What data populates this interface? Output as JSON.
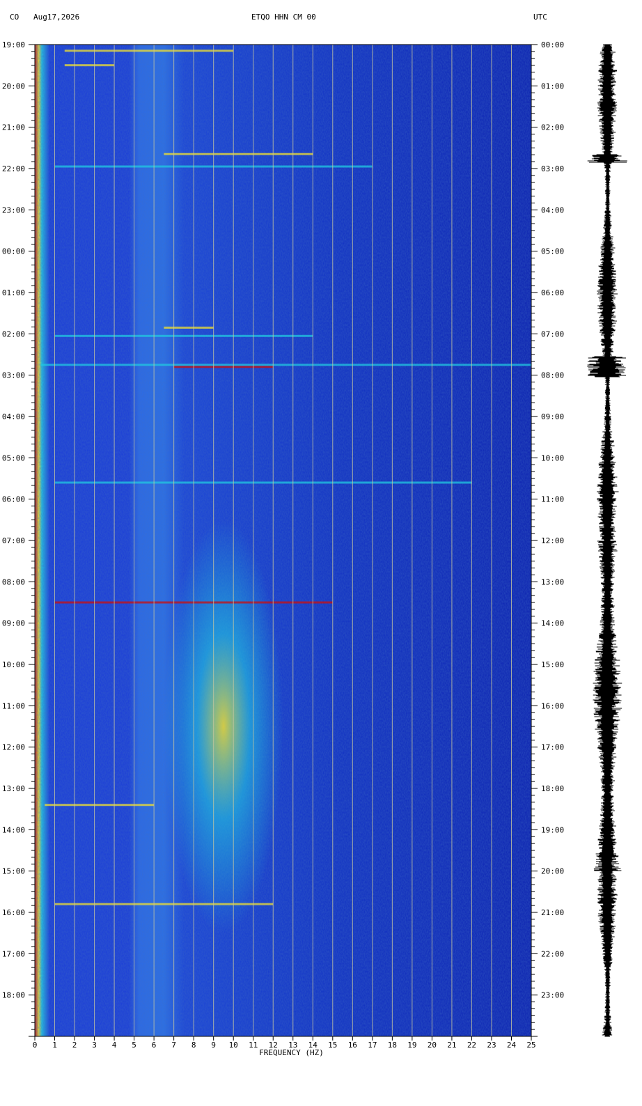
{
  "header": {
    "network": "CO",
    "date": "Aug17,2026",
    "station": "ETQO HHN CM 00",
    "timezone": "UTC"
  },
  "chart_data": {
    "type": "heatmap",
    "xlabel": "FREQUENCY (HZ)",
    "xlim": [
      0,
      25
    ],
    "x_ticks": [
      "0",
      "1",
      "2",
      "3",
      "4",
      "5",
      "6",
      "7",
      "8",
      "9",
      "10",
      "11",
      "12",
      "13",
      "14",
      "15",
      "16",
      "17",
      "18",
      "19",
      "20",
      "21",
      "22",
      "23",
      "24",
      "25"
    ],
    "y_labels_left": [
      "19:00",
      "20:00",
      "21:00",
      "22:00",
      "23:00",
      "00:00",
      "01:00",
      "02:00",
      "03:00",
      "04:00",
      "05:00",
      "06:00",
      "07:00",
      "08:00",
      "09:00",
      "10:00",
      "11:00",
      "12:00",
      "13:00",
      "14:00",
      "15:00",
      "16:00",
      "17:00",
      "18:00"
    ],
    "y_labels_right": [
      "00:00",
      "01:00",
      "02:00",
      "03:00",
      "04:00",
      "05:00",
      "06:00",
      "07:00",
      "08:00",
      "09:00",
      "10:00",
      "11:00",
      "12:00",
      "13:00",
      "14:00",
      "15:00",
      "16:00",
      "17:00",
      "18:00",
      "19:00",
      "20:00",
      "21:00",
      "22:00",
      "23:00"
    ],
    "ylim_hours": [
      0,
      24
    ],
    "grid": true,
    "colors": {
      "background": "#0a1fb0",
      "low": "#1a3cd8",
      "mid": "#22c8e0",
      "high": "#f0e030",
      "peak": "#c81010",
      "grid": "#c8c8a0"
    }
  }
}
